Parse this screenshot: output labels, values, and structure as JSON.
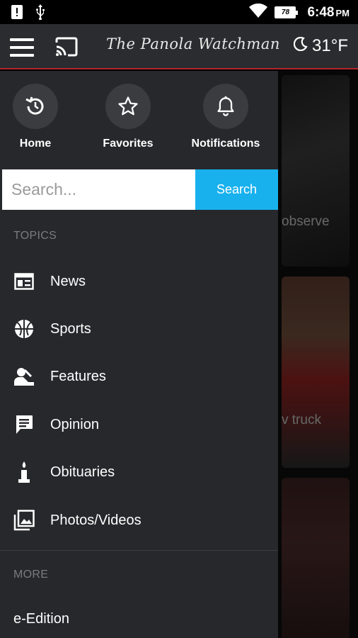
{
  "status": {
    "time": "6:48",
    "ampm": "PM",
    "battery": "78"
  },
  "header": {
    "masthead": "The Panola Watchman",
    "temperature": "31°F"
  },
  "quick_actions": [
    {
      "label": "Home",
      "icon": "history-icon"
    },
    {
      "label": "Favorites",
      "icon": "star-icon"
    },
    {
      "label": "Notifications",
      "icon": "bell-icon"
    }
  ],
  "search": {
    "placeholder": "Search...",
    "button_label": "Search"
  },
  "topics": {
    "heading": "TOPICS",
    "items": [
      {
        "label": "News",
        "icon": "newspaper-icon"
      },
      {
        "label": "Sports",
        "icon": "basketball-icon"
      },
      {
        "label": "Features",
        "icon": "person-icon"
      },
      {
        "label": "Opinion",
        "icon": "comment-icon"
      },
      {
        "label": "Obituaries",
        "icon": "candle-icon"
      },
      {
        "label": "Photos/Videos",
        "icon": "photos-icon"
      }
    ]
  },
  "more": {
    "heading": "MORE",
    "items": [
      {
        "label": "e-Edition"
      }
    ]
  },
  "background_feed": {
    "card1_text": "observe",
    "card2_text": "v truck"
  },
  "colors": {
    "drawer_bg": "#27282c",
    "appbar_bg": "#2b2c30",
    "accent": "#18b1ee",
    "appbar_border": "#b3262a"
  }
}
